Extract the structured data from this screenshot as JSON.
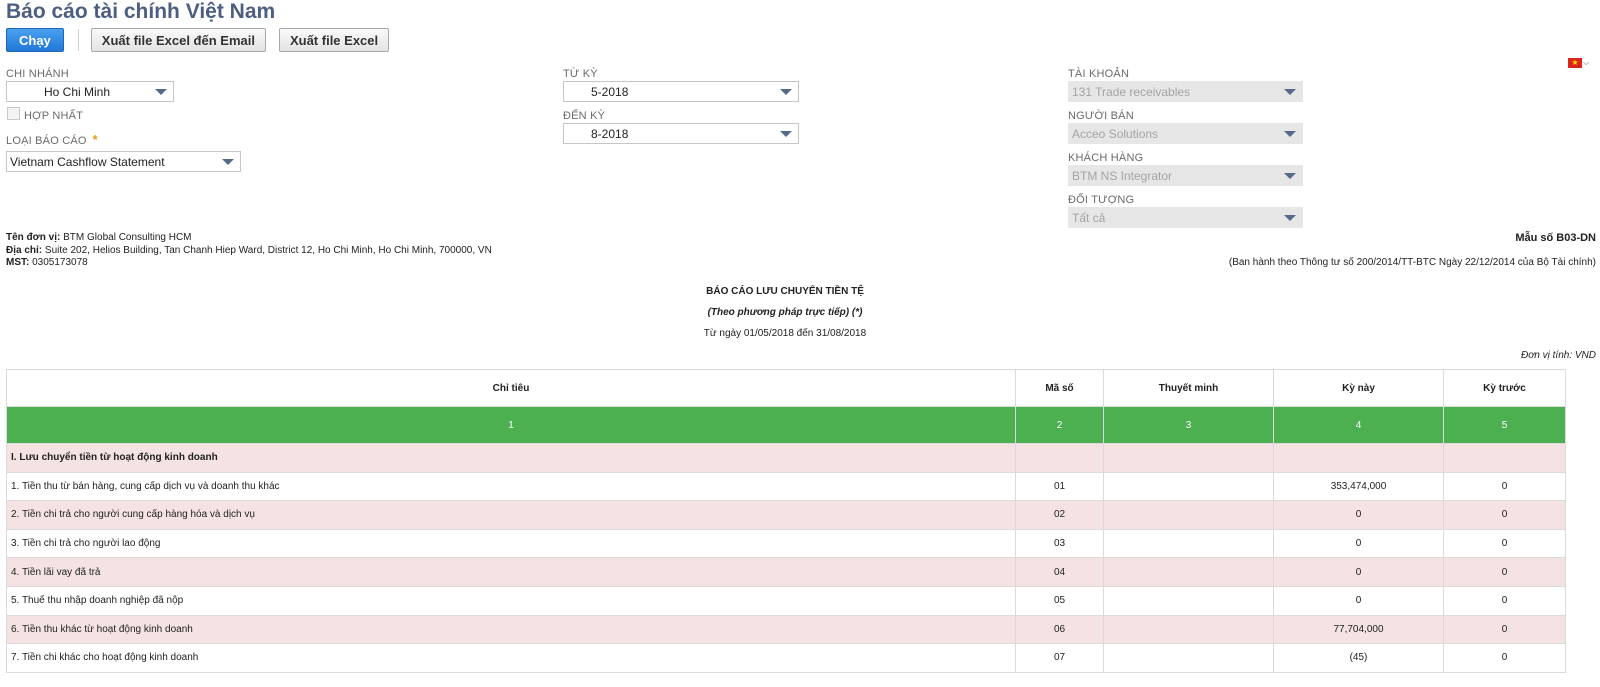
{
  "page": {
    "title": "Báo cáo tài chính Việt Nam"
  },
  "toolbar": {
    "run_label": "Chạy",
    "export_email_label": "Xuất file Excel đến Email",
    "export_excel_label": "Xuất file Excel"
  },
  "filters": {
    "branch": {
      "label": "CHI NHÁNH",
      "value": "Ho Chi Minh"
    },
    "consolidated": {
      "label": "HỢP NHẤT",
      "checked": false
    },
    "report_type": {
      "label": "LOẠI BÁO CÁO",
      "required_mark": "*",
      "value": "Vietnam Cashflow Statement"
    },
    "from_period": {
      "label": "TỪ KỲ",
      "value": "5-2018"
    },
    "to_period": {
      "label": "ĐẾN KỲ",
      "value": "8-2018"
    },
    "account": {
      "label": "TÀI KHOẢN",
      "value": "131 Trade receivables"
    },
    "vendor": {
      "label": "NGƯỜI BÁN",
      "value": "Acceo Solutions"
    },
    "customer": {
      "label": "KHÁCH HÀNG",
      "value": "BTM NS Integrator"
    },
    "subject": {
      "label": "ĐỐI TƯỢNG",
      "value": "Tất cả"
    }
  },
  "language_flag": {
    "icon": "vietnam-flag-icon",
    "color": "#da251d"
  },
  "company": {
    "name_label": "Tên đơn vị:",
    "name": "BTM Global Consulting HCM",
    "address_label": "Địa chỉ:",
    "address": "Suite 202, Helios Building, Tan Chanh Hiep Ward, District 12, Ho Chi Minh, Ho Chi Minh, 700000, VN",
    "tax_label": "MST:",
    "tax_id": "0305173078"
  },
  "form": {
    "number": "Mẫu số B03-DN",
    "decree": "(Ban hành theo Thông tư số 200/2014/TT-BTC Ngày 22/12/2014 của Bộ Tài chính)"
  },
  "report": {
    "title": "BÁO CÁO LƯU CHUYỂN TIỀN TỆ",
    "method": "(Theo phương pháp trực tiếp) (*)",
    "period": "Từ ngày 01/05/2018 đến 31/08/2018",
    "unit": "Đơn vị tính: VND"
  },
  "table": {
    "headers": [
      "Chỉ tiêu",
      "Mã số",
      "Thuyết minh",
      "Kỳ này",
      "Kỳ trước"
    ],
    "column_numbers": [
      "1",
      "2",
      "3",
      "4",
      "5"
    ],
    "header_band_color": "#4caf50",
    "rows": [
      {
        "item": "I. Lưu chuyển tiền từ hoạt động kinh doanh",
        "code": "",
        "note": "",
        "current": "",
        "previous": ""
      },
      {
        "item": "1. Tiền thu từ bán hàng, cung cấp dịch vụ và doanh thu khác",
        "code": "01",
        "note": "",
        "current": "353,474,000",
        "previous": "0"
      },
      {
        "item": "2. Tiền chi trả cho người cung cấp hàng hóa và dịch vụ",
        "code": "02",
        "note": "",
        "current": "0",
        "previous": "0"
      },
      {
        "item": "3. Tiền chi trả cho người lao động",
        "code": "03",
        "note": "",
        "current": "0",
        "previous": "0"
      },
      {
        "item": "4. Tiền lãi vay đã trả",
        "code": "04",
        "note": "",
        "current": "0",
        "previous": "0"
      },
      {
        "item": "5. Thuế thu nhập doanh nghiệp đã nộp",
        "code": "05",
        "note": "",
        "current": "0",
        "previous": "0"
      },
      {
        "item": "6. Tiền thu khác từ hoạt động kinh doanh",
        "code": "06",
        "note": "",
        "current": "77,704,000",
        "previous": "0"
      },
      {
        "item": "7. Tiền chi khác cho hoạt động kinh doanh",
        "code": "07",
        "note": "",
        "current": "(45)",
        "previous": "0"
      }
    ]
  }
}
